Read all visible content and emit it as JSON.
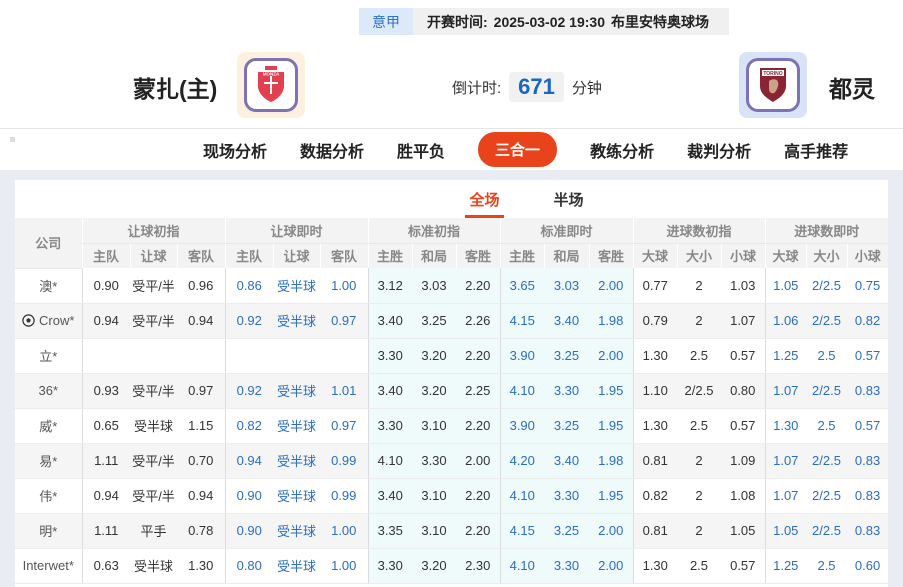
{
  "meta": {
    "league": "意甲",
    "kickoff_label": "开赛时间:",
    "kickoff_time": "2025-03-02 19:30",
    "venue": "布里安特奥球场"
  },
  "match": {
    "home_name": "蒙扎(主)",
    "away_name": "都灵",
    "countdown_label": "倒计时:",
    "countdown_value": "671",
    "countdown_unit": "分钟"
  },
  "nav": {
    "items": [
      {
        "label": "现场分析",
        "active": false
      },
      {
        "label": "数据分析",
        "active": false
      },
      {
        "label": "胜平负",
        "active": false
      },
      {
        "label": "三合一",
        "active": true
      },
      {
        "label": "教练分析",
        "active": false
      },
      {
        "label": "裁判分析",
        "active": false
      },
      {
        "label": "高手推荐",
        "active": false
      }
    ]
  },
  "subtabs": {
    "items": [
      {
        "label": "全场",
        "active": true
      },
      {
        "label": "半场",
        "active": false
      }
    ]
  },
  "table": {
    "company_header": "公司",
    "groups": [
      {
        "label": "让球初指",
        "cols": [
          "主队",
          "让球",
          "客队"
        ]
      },
      {
        "label": "让球即时",
        "cols": [
          "主队",
          "让球",
          "客队"
        ]
      },
      {
        "label": "标准初指",
        "cols": [
          "主胜",
          "和局",
          "客胜"
        ]
      },
      {
        "label": "标准即时",
        "cols": [
          "主胜",
          "和局",
          "客胜"
        ]
      },
      {
        "label": "进球数初指",
        "cols": [
          "大球",
          "大小",
          "小球"
        ]
      },
      {
        "label": "进球数即时",
        "cols": [
          "大球",
          "大小",
          "小球"
        ]
      }
    ],
    "rows": [
      {
        "company": "澳*",
        "icon": false,
        "hi": [
          "0.90",
          "受平/半",
          "0.96"
        ],
        "hl": [
          "0.86",
          "受半球",
          "1.00"
        ],
        "si": [
          "3.12",
          "3.03",
          "2.20"
        ],
        "sl": [
          "3.65",
          "3.03",
          "2.00"
        ],
        "gi": [
          "0.77",
          "2",
          "1.03"
        ],
        "gl": [
          "1.05",
          "2/2.5",
          "0.75"
        ]
      },
      {
        "company": "Crow*",
        "icon": true,
        "hi": [
          "0.94",
          "受平/半",
          "0.94"
        ],
        "hl": [
          "0.92",
          "受半球",
          "0.97"
        ],
        "si": [
          "3.40",
          "3.25",
          "2.26"
        ],
        "sl": [
          "4.15",
          "3.40",
          "1.98"
        ],
        "gi": [
          "0.79",
          "2",
          "1.07"
        ],
        "gl": [
          "1.06",
          "2/2.5",
          "0.82"
        ]
      },
      {
        "company": "立*",
        "icon": false,
        "hi": [
          "",
          "",
          ""
        ],
        "hl": [
          "",
          "",
          ""
        ],
        "si": [
          "3.30",
          "3.20",
          "2.20"
        ],
        "sl": [
          "3.90",
          "3.25",
          "2.00"
        ],
        "gi": [
          "1.30",
          "2.5",
          "0.57"
        ],
        "gl": [
          "1.25",
          "2.5",
          "0.57"
        ]
      },
      {
        "company": "36*",
        "icon": false,
        "hi": [
          "0.93",
          "受平/半",
          "0.97"
        ],
        "hl": [
          "0.92",
          "受半球",
          "1.01"
        ],
        "si": [
          "3.40",
          "3.20",
          "2.25"
        ],
        "sl": [
          "4.10",
          "3.30",
          "1.95"
        ],
        "gi": [
          "1.10",
          "2/2.5",
          "0.80"
        ],
        "gl": [
          "1.07",
          "2/2.5",
          "0.83"
        ]
      },
      {
        "company": "威*",
        "icon": false,
        "hi": [
          "0.65",
          "受半球",
          "1.15"
        ],
        "hl": [
          "0.82",
          "受半球",
          "0.97"
        ],
        "si": [
          "3.30",
          "3.10",
          "2.20"
        ],
        "sl": [
          "3.90",
          "3.25",
          "1.95"
        ],
        "gi": [
          "1.30",
          "2.5",
          "0.57"
        ],
        "gl": [
          "1.30",
          "2.5",
          "0.57"
        ]
      },
      {
        "company": "易*",
        "icon": false,
        "hi": [
          "1.11",
          "受平/半",
          "0.70"
        ],
        "hl": [
          "0.94",
          "受半球",
          "0.99"
        ],
        "si": [
          "4.10",
          "3.30",
          "2.00"
        ],
        "sl": [
          "4.20",
          "3.40",
          "1.98"
        ],
        "gi": [
          "0.81",
          "2",
          "1.09"
        ],
        "gl": [
          "1.07",
          "2/2.5",
          "0.83"
        ]
      },
      {
        "company": "伟*",
        "icon": false,
        "hi": [
          "0.94",
          "受平/半",
          "0.94"
        ],
        "hl": [
          "0.90",
          "受半球",
          "0.99"
        ],
        "si": [
          "3.40",
          "3.10",
          "2.20"
        ],
        "sl": [
          "4.10",
          "3.30",
          "1.95"
        ],
        "gi": [
          "0.82",
          "2",
          "1.08"
        ],
        "gl": [
          "1.07",
          "2/2.5",
          "0.83"
        ]
      },
      {
        "company": "明*",
        "icon": false,
        "hi": [
          "1.11",
          "平手",
          "0.78"
        ],
        "hl": [
          "0.90",
          "受半球",
          "1.00"
        ],
        "si": [
          "3.35",
          "3.10",
          "2.20"
        ],
        "sl": [
          "4.15",
          "3.25",
          "2.00"
        ],
        "gi": [
          "0.81",
          "2",
          "1.05"
        ],
        "gl": [
          "1.05",
          "2/2.5",
          "0.83"
        ]
      },
      {
        "company": "Interwet*",
        "icon": false,
        "hi": [
          "0.63",
          "受半球",
          "1.30"
        ],
        "hl": [
          "0.80",
          "受半球",
          "1.00"
        ],
        "si": [
          "3.30",
          "3.20",
          "2.30"
        ],
        "sl": [
          "4.10",
          "3.30",
          "2.00"
        ],
        "gi": [
          "1.30",
          "2.5",
          "0.57"
        ],
        "gl": [
          "1.25",
          "2.5",
          "0.60"
        ]
      }
    ]
  },
  "colors": {
    "accent": "#e8431b",
    "live_blue": "#2b6dc0",
    "std_column_bg": "#effbfb",
    "league_badge_bg": "#dce9f8",
    "league_badge_text": "#2f72c4",
    "countdown_blue": "#1b66c4",
    "home_logo_bg": "#fcf1df",
    "away_logo_bg": "#d8e4f6",
    "logo_border": "#7d72b4"
  }
}
